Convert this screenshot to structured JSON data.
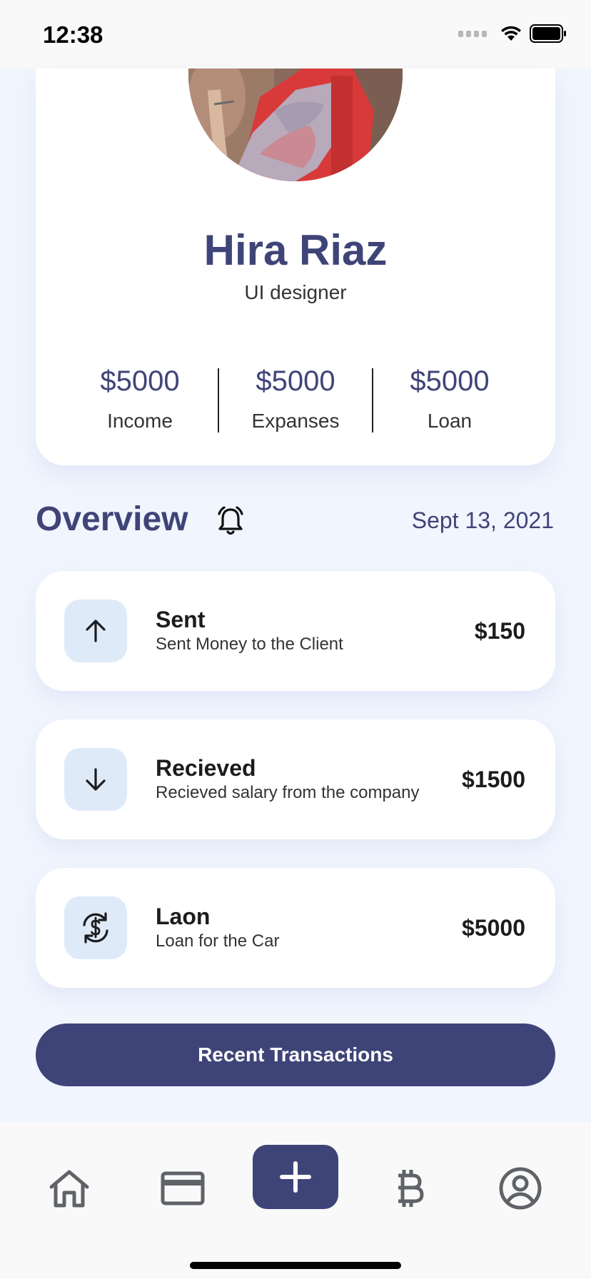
{
  "status_bar": {
    "time": "12:38"
  },
  "profile": {
    "name": "Hira Riaz",
    "role": "UI designer",
    "stats": [
      {
        "value": "$5000",
        "label": "Income"
      },
      {
        "value": "$5000",
        "label": "Expanses"
      },
      {
        "value": "$5000",
        "label": "Loan"
      }
    ]
  },
  "overview": {
    "title": "Overview",
    "date": "Sept 13, 2021",
    "icon": "bell-icon"
  },
  "transactions": [
    {
      "title": "Sent",
      "description": "Sent Money to the Client",
      "amount": "$150",
      "icon": "arrow-up-icon"
    },
    {
      "title": "Recieved",
      "description": "Recieved salary from the company",
      "amount": "$1500",
      "icon": "arrow-down-icon"
    },
    {
      "title": "Laon",
      "description": "Loan for the Car",
      "amount": "$5000",
      "icon": "dollar-exchange-icon"
    }
  ],
  "recent_button": {
    "label": "Recent Transactions"
  },
  "tab_bar": {
    "items": [
      "home-icon",
      "card-icon",
      "plus-icon",
      "bitcoin-icon",
      "profile-icon"
    ]
  },
  "colors": {
    "accent": "#3f4478",
    "background": "#f1f5fe",
    "icon_tile": "#dfeaf9",
    "tab_icon": "#5f6368"
  }
}
